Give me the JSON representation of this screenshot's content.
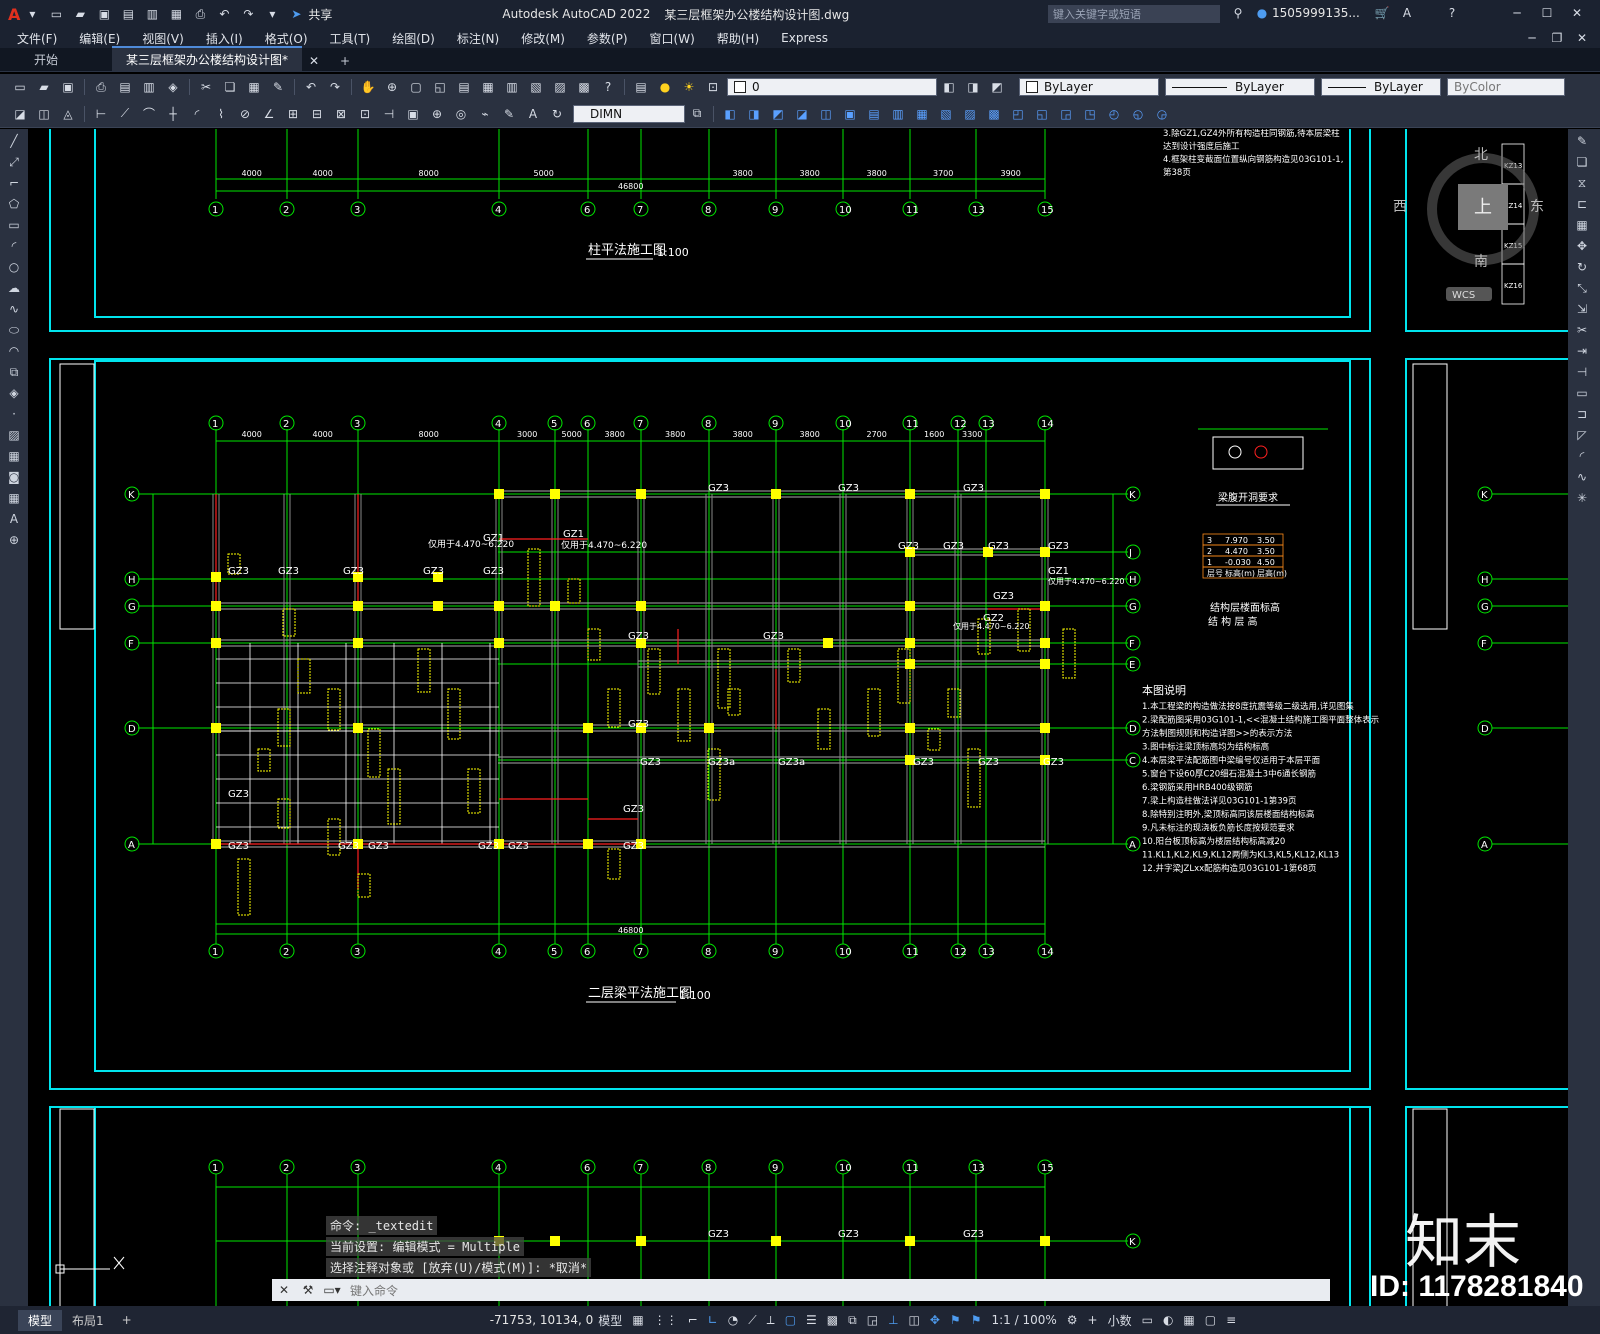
{
  "titlebar": {
    "app_title": "Autodesk AutoCAD 2022",
    "file_title": "某三层框架办公楼结构设计图.dwg",
    "share_label": "共享",
    "search_placeholder": "键入关键字或短语",
    "user": "1505999135...",
    "help": "?"
  },
  "menu": [
    "文件(F)",
    "编辑(E)",
    "视图(V)",
    "插入(I)",
    "格式(O)",
    "工具(T)",
    "绘图(D)",
    "标注(N)",
    "修改(M)",
    "参数(P)",
    "窗口(W)",
    "帮助(H)",
    "Express"
  ],
  "tabs": {
    "start": "开始",
    "doc": "某三层框架办公楼结构设计图*",
    "add": "+"
  },
  "ribbon": {
    "layer_value": "0",
    "color": "ByLayer",
    "linetype": "ByLayer",
    "lineweight": "ByLayer",
    "plotstyle": "ByColor",
    "dimstyle": "DIMN"
  },
  "viewcube": {
    "north": "北",
    "south": "南",
    "west": "西",
    "east": "东",
    "top": "上",
    "wcs": "WCS"
  },
  "drawing": {
    "title_top": "柱平法施工图",
    "scale_top": "1:100",
    "title_main": "二层梁平法施工图",
    "scale_main": "1:100",
    "axes_x": [
      "1",
      "2",
      "3",
      "4",
      "5",
      "6",
      "7",
      "8",
      "9",
      "10",
      "11",
      "12",
      "13",
      "14",
      "15"
    ],
    "axes_y": [
      "K",
      "J",
      "H",
      "G",
      "F",
      "E",
      "D",
      "C",
      "A"
    ],
    "dims_top": [
      "4000",
      "4000",
      "8000",
      "5000",
      "3800",
      "3800",
      "3800",
      "3700",
      "3900"
    ],
    "dims_main": [
      "4000",
      "4000",
      "8000",
      "3000",
      "5000",
      "3800",
      "3800",
      "3800",
      "3800",
      "2700",
      "1600",
      "3300"
    ],
    "total_dim": "46800",
    "gz_labels": [
      "GZ1",
      "GZ2",
      "GZ3",
      "GZ3a"
    ],
    "gz1_note": "仅用于4.470~6.220",
    "notes_top": [
      "3.除GZ1,GZ4外所有构造柱同钢筋,待本层梁柱",
      "   达到设计强度后施工",
      "4.框架柱变截面位置纵向钢筋构造见03G101-1,",
      "   第38页"
    ],
    "hole_title": "梁腹开洞要求",
    "elev_table_title": "结构层楼面标高",
    "elev_table_sub": "结 构 层 高",
    "elev_rows": [
      [
        "3",
        "7.970",
        "3.50"
      ],
      [
        "2",
        "4.470",
        "3.50"
      ],
      [
        "1",
        "-0.030",
        "4.50"
      ],
      [
        "层号",
        "标高(m)",
        "层高(m)"
      ]
    ],
    "notes_title": "本图说明",
    "notes": [
      "1.本工程梁的构造做法按8度抗震等级二级选用,详见图集",
      "2.梁配筋图采用03G101-1,<<混凝土结构施工图平面整体表示",
      "  方法制图规则和构造详图>>的表示方法",
      "3.图中标注梁顶标高均为结构标高",
      "4.本层梁平法配筋图中梁编号仅适用于本层平面",
      "5.窗台下设60厚C20细石混凝土3中6通长钢筋",
      "6.梁钢筋采用HRB400级钢筋",
      "7.梁上构造柱做法详见03G101-1第39页",
      "8.除特别注明外,梁顶标高同该层楼面结构标高",
      "9.凡未标注的现浇板负筋长度按规范要求",
      "10.阳台板顶标高为楼层结构标高减20",
      "11.KL1,KL2,KL9,KL12两侧为KL3,KL5,KL12,KL13",
      "12.井字梁JZLxx配筋构造见03G101-1第68页"
    ],
    "kz_labels": [
      "KZ13",
      "KZ14",
      "KZ15",
      "KZ16"
    ]
  },
  "command": {
    "history": [
      "命令: _textedit",
      "当前设置: 编辑模式 = Multiple",
      "选择注释对象或 [放弃(U)/模式(M)]: *取消*"
    ],
    "placeholder": "键入命令"
  },
  "status": {
    "model_tab": "模型",
    "layout_tab": "布局1",
    "add": "+",
    "coords": "-71753, 10134, 0",
    "model": "模型",
    "scale": "1:1 / 100%",
    "units": "小数"
  },
  "watermark": {
    "logo": "知末",
    "id": "ID: 1178281840"
  },
  "colors": {
    "bg": "#000000",
    "grid": "#00e600",
    "frame": "#00e5ee",
    "column": "#ffff00",
    "beam_red": "#ff2020",
    "text": "#ffffff"
  }
}
